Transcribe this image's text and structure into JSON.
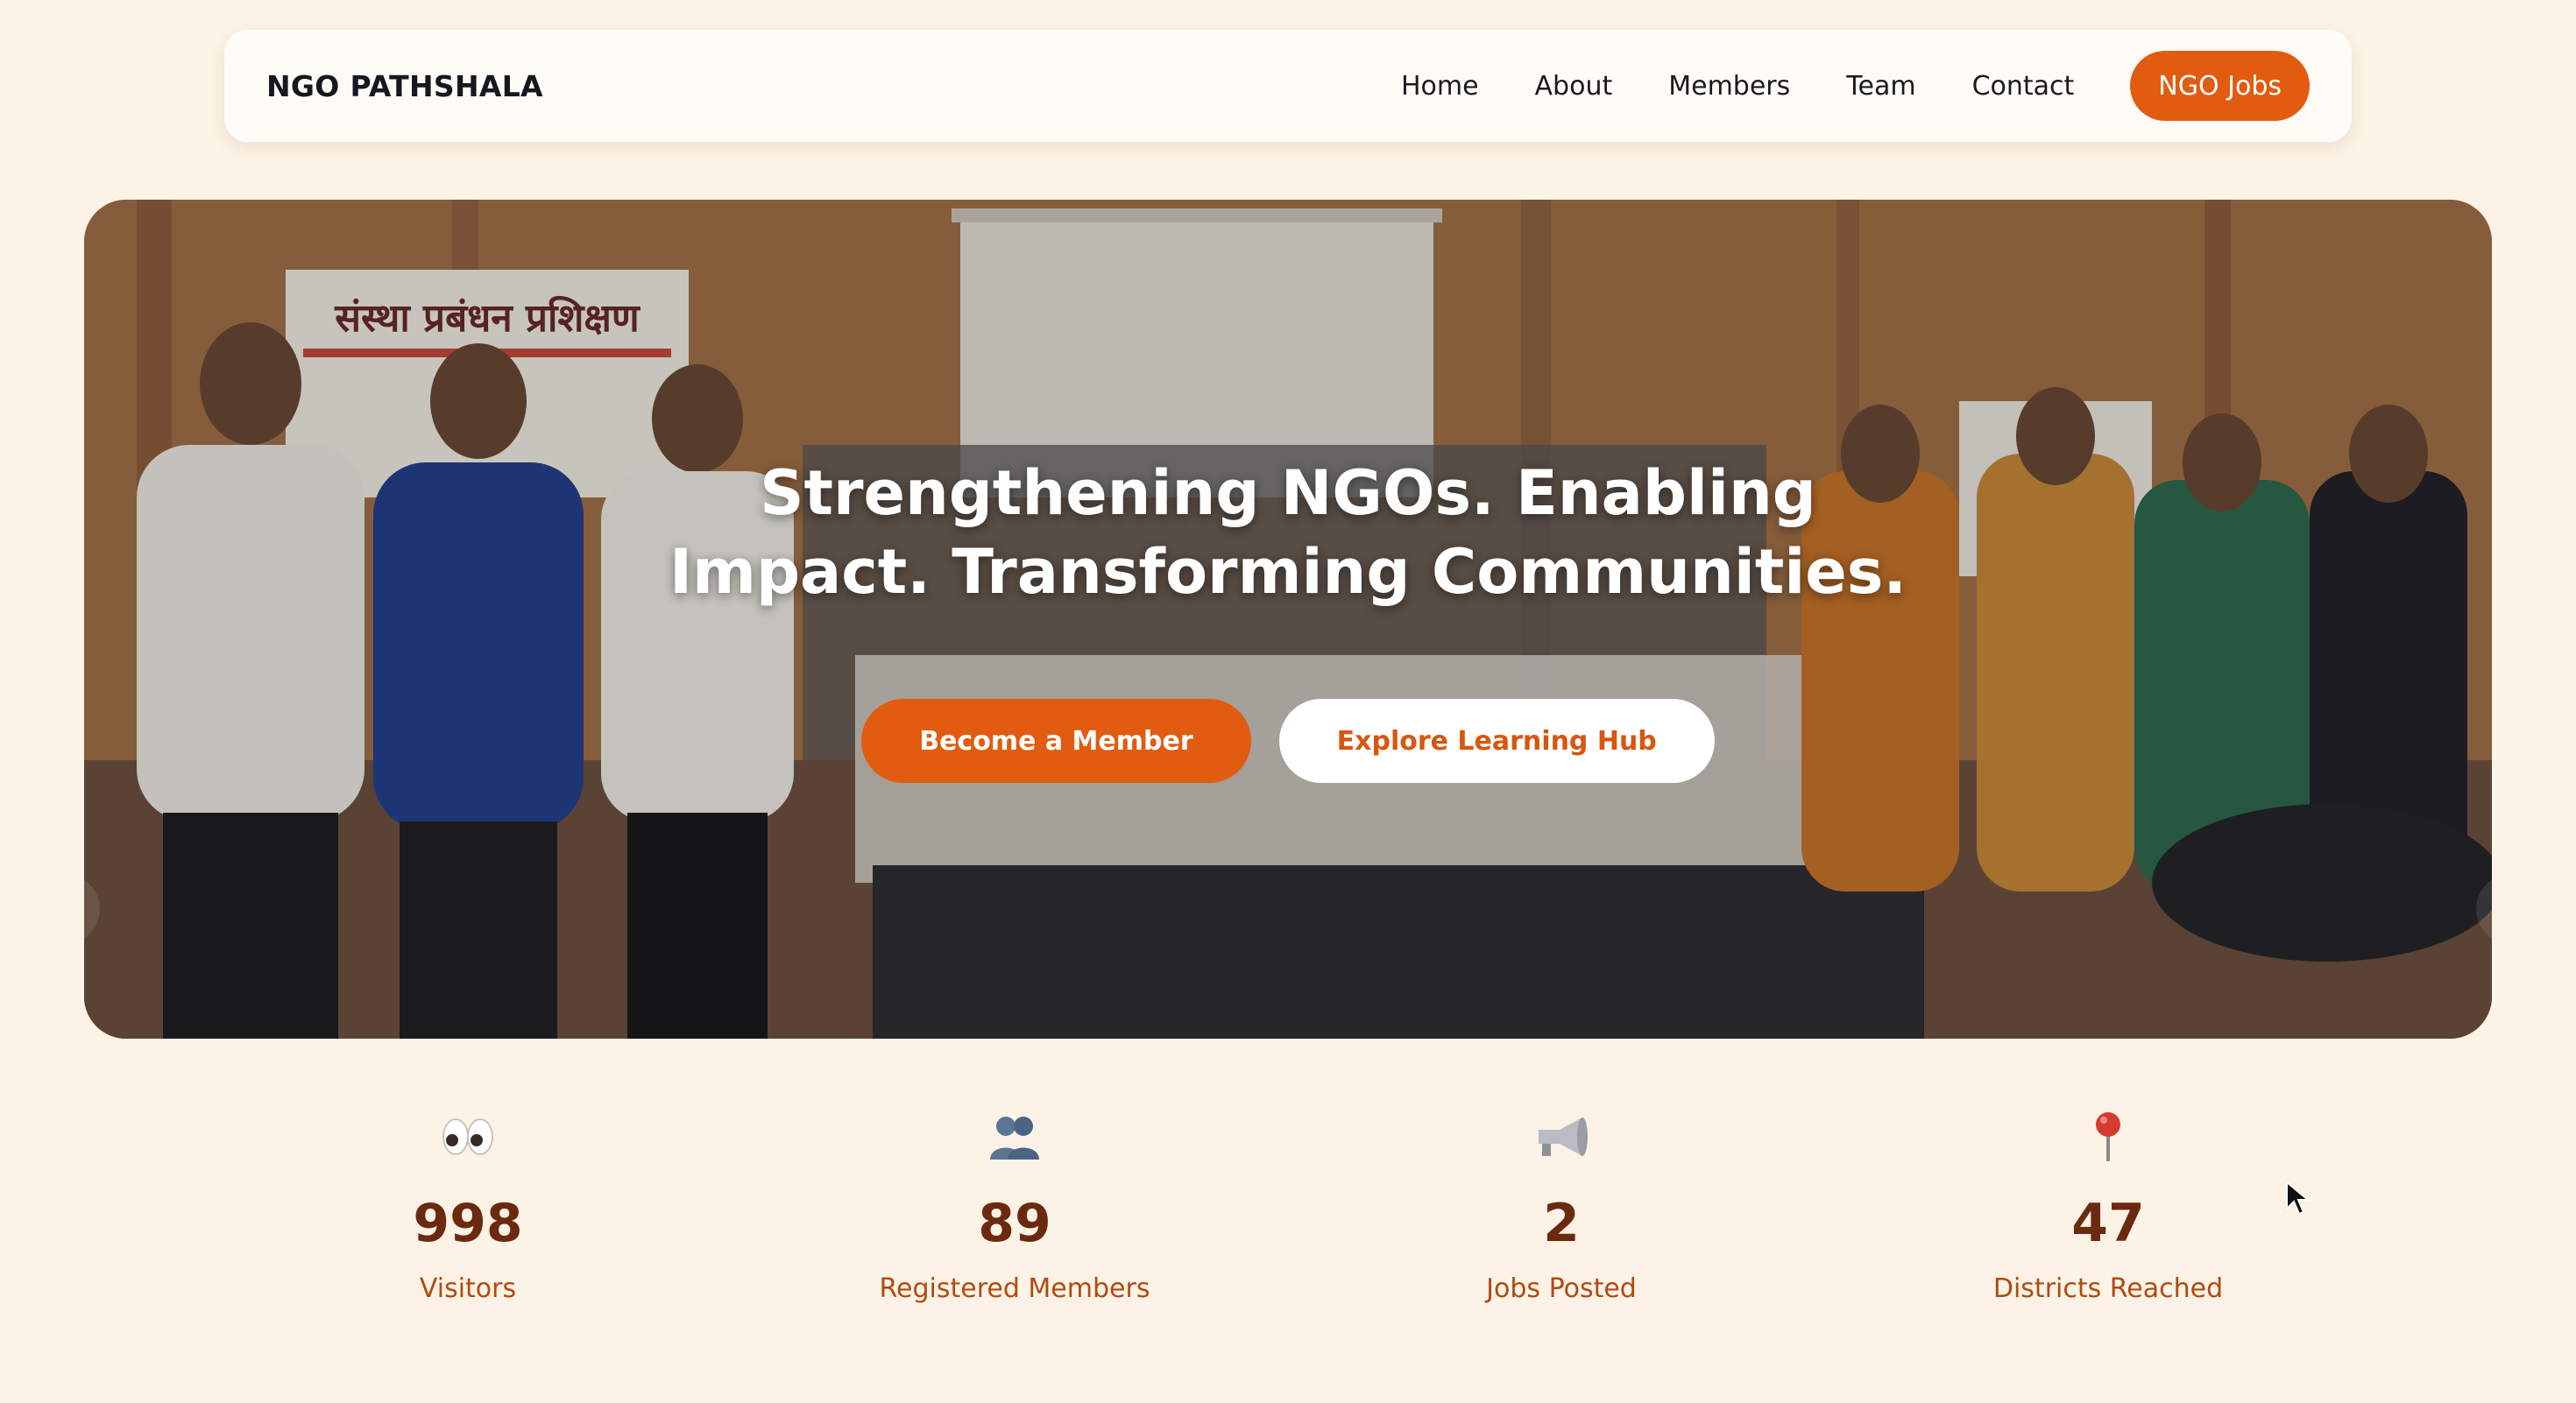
{
  "navbar": {
    "brand": "NGO PATHSHALA",
    "links": [
      "Home",
      "About",
      "Members",
      "Team",
      "Contact"
    ],
    "cta_label": "NGO Jobs"
  },
  "hero": {
    "title_line1": "Strengthening NGOs. Enabling",
    "title_line2": "Impact. Transforming Communities.",
    "primary_button": "Become a Member",
    "secondary_button": "Explore Learning Hub",
    "photo_banner_text": "संस्था प्रबंधन प्रशिक्षण"
  },
  "stats": [
    {
      "icon": "eyes-icon",
      "number": "998",
      "label": "Visitors"
    },
    {
      "icon": "people-icon",
      "number": "89",
      "label": "Registered Members"
    },
    {
      "icon": "megaphone-icon",
      "number": "2",
      "label": "Jobs Posted"
    },
    {
      "icon": "pin-icon",
      "number": "47",
      "label": "Districts Reached"
    }
  ],
  "colors": {
    "page_bg": "#fcf3e6",
    "accent": "#e15c10",
    "stat_number": "#6b2a10",
    "stat_label": "#b14a12"
  }
}
